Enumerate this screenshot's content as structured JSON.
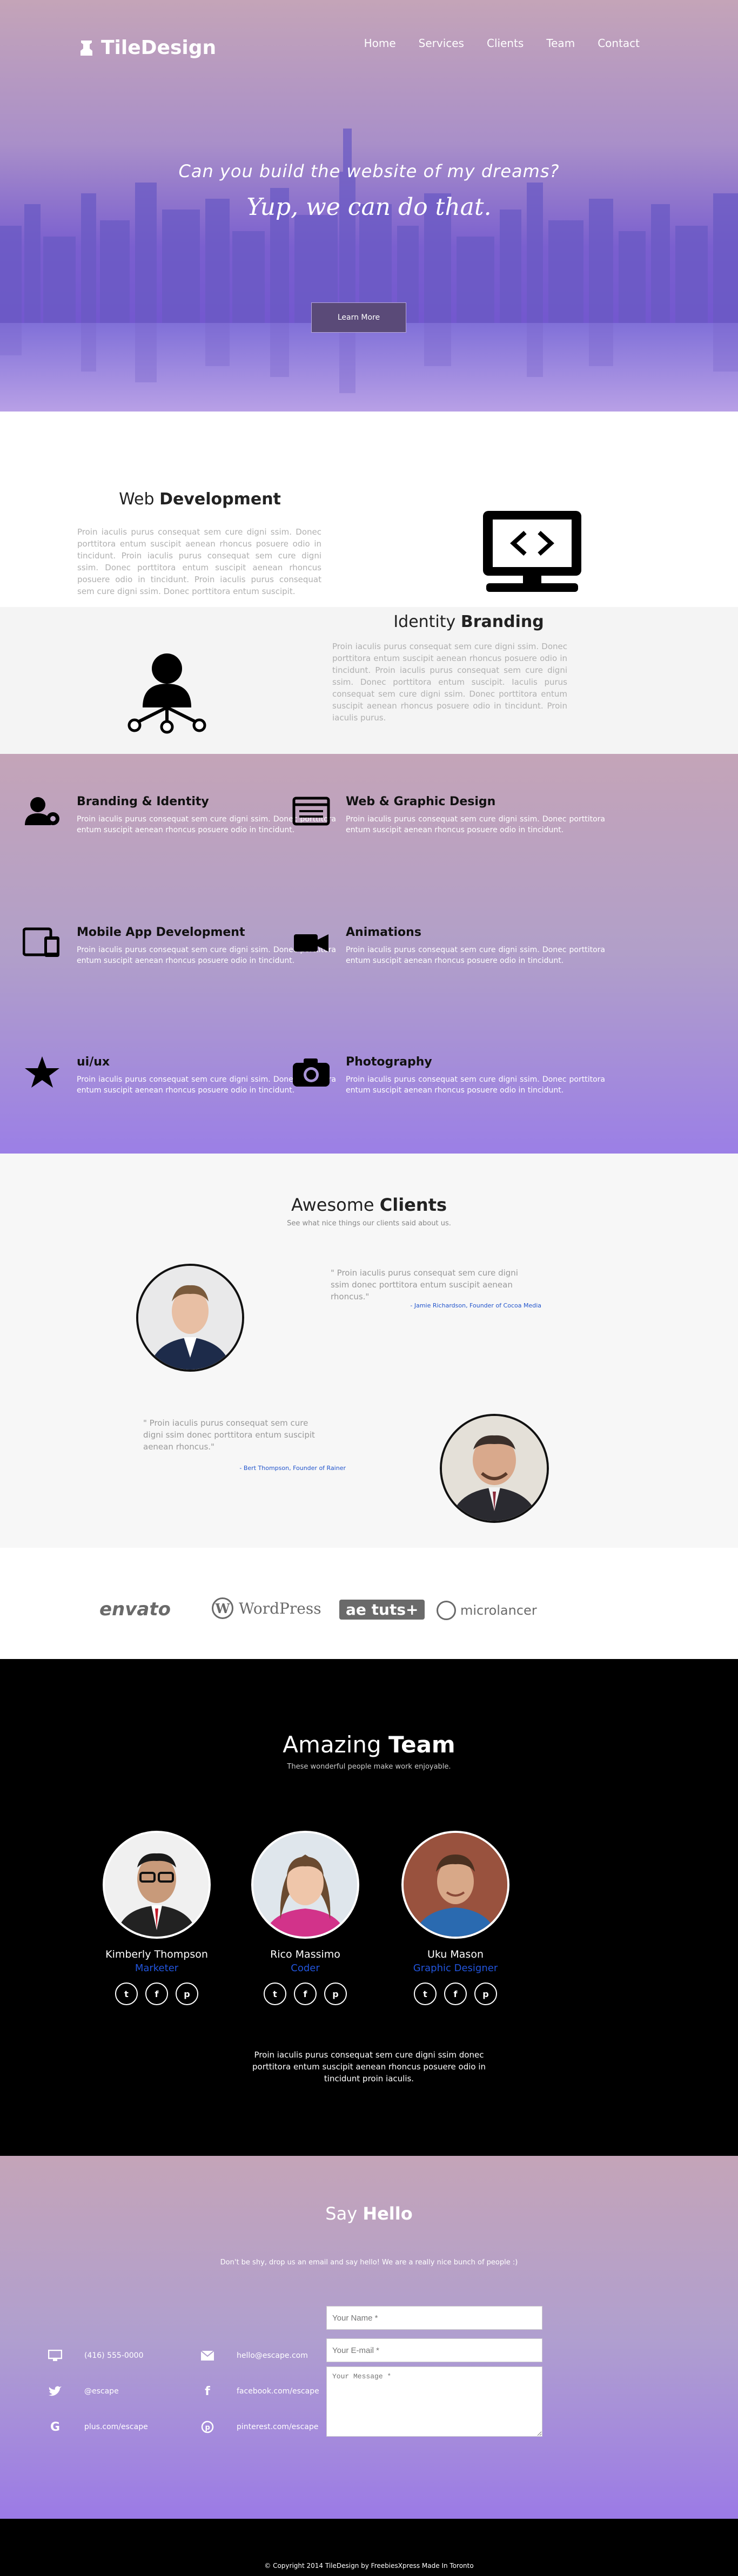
{
  "header": {
    "logo_text": "TileDesign",
    "nav": [
      "Home",
      "Services",
      "Clients",
      "Team",
      "Contact"
    ]
  },
  "hero": {
    "question": "Can you build the website of my dreams?",
    "answer": "Yup, we can do that.",
    "button": "Learn More"
  },
  "services": {
    "web_dev": {
      "title_a": "Web ",
      "title_b": "Development",
      "text": "Proin iaculis purus consequat sem cure digni ssim. Donec porttitora entum suscipit aenean rhoncus posuere odio in tincidunt. Proin iaculis purus consequat sem cure digni ssim. Donec porttitora entum suscipit aenean rhoncus posuere odio in tincidunt. Proin iaculis purus consequat sem cure digni ssim. Donec porttitora entum suscipit."
    },
    "branding": {
      "title_a": "Identity ",
      "title_b": "Branding",
      "text": "Proin iaculis purus consequat sem cure digni ssim. Donec porttitora entum suscipit aenean rhoncus posuere odio in tincidunt. Proin iaculis purus consequat sem cure digni ssim. Donec porttitora entum suscipit. Iaculis purus consequat sem cure digni ssim. Donec porttitora entum suscipit aenean rhoncus posuere odio in tincidunt. Proin iaculis purus."
    }
  },
  "features": [
    {
      "title": "Branding & Identity",
      "icon": "branding-icon",
      "text": "Proin iaculis purus consequat sem cure digni ssim. Donec porttitora entum suscipit aenean rhoncus posuere odio in tincidunt."
    },
    {
      "title": "Web & Graphic Design",
      "icon": "browser-icon",
      "text": "Proin iaculis purus consequat sem cure digni ssim. Donec porttitora entum suscipit aenean rhoncus posuere odio in tincidunt."
    },
    {
      "title": "Mobile App Development",
      "icon": "devices-icon",
      "text": "Proin iaculis purus consequat sem cure digni ssim. Donec porttitora entum suscipit aenean rhoncus posuere odio in tincidunt."
    },
    {
      "title": "Animations",
      "icon": "video-camera-icon",
      "text": "Proin iaculis purus consequat sem cure digni ssim. Donec porttitora entum suscipit aenean rhoncus posuere odio in tincidunt."
    },
    {
      "title": "ui/ux",
      "icon": "star-icon",
      "text": "Proin iaculis purus consequat sem cure digni ssim. Donec porttitora entum suscipit aenean rhoncus posuere odio in tincidunt."
    },
    {
      "title": "Photography",
      "icon": "camera-icon",
      "text": "Proin iaculis purus consequat sem cure digni ssim. Donec porttitora entum suscipit aenean rhoncus posuere odio in tincidunt."
    }
  ],
  "clients": {
    "title_a": "Awesome ",
    "title_b": "Clients",
    "subtitle": "See what nice things our clients said about us.",
    "testimonials": [
      {
        "quote": "\" Proin iaculis purus consequat sem cure digni ssim donec porttitora entum suscipit aenean rhoncus.\"",
        "author": "- Jamie Richardson, Founder of Cocoa Media"
      },
      {
        "quote": "\" Proin iaculis purus consequat sem cure digni ssim donec porttitora entum suscipit aenean rhoncus.\"",
        "author": "- Bert Thompson, Founder of Rainer"
      }
    ]
  },
  "logos": [
    "envato",
    "WordPress",
    "tuts+",
    "microlancer"
  ],
  "team": {
    "title_a": "Amazing ",
    "title_b": "Team",
    "subtitle": "These wonderful people make work enjoyable.",
    "members": [
      {
        "name": "Kimberly Thompson",
        "role": "Marketer"
      },
      {
        "name": "Rico Massimo",
        "role": "Coder"
      },
      {
        "name": "Uku Mason",
        "role": "Graphic Designer"
      }
    ],
    "text": "Proin iaculis purus consequat sem cure digni ssim donec porttitora entum suscipit aenean rhoncus posuere odio in tincidunt proin iaculis."
  },
  "contact": {
    "title_a": "Say ",
    "title_b": "Hello",
    "subtitle": "Don't be shy, drop us an email and say hello! We are a really nice bunch of people :)",
    "info": [
      {
        "icon": "monitor-icon",
        "text": "(416) 555-0000"
      },
      {
        "icon": "mail-icon",
        "text": "hello@escape.com"
      },
      {
        "icon": "twitter-icon",
        "text": "@escape"
      },
      {
        "icon": "facebook-icon",
        "text": "facebook.com/escape"
      },
      {
        "icon": "google-icon",
        "text": "plus.com/escape"
      },
      {
        "icon": "pinterest-icon",
        "text": "pinterest.com/escape"
      }
    ],
    "form": {
      "name_placeholder": "Your Name *",
      "email_placeholder": "Your E-mail *",
      "message_placeholder": "Your Message *"
    }
  },
  "footer": {
    "text": "© Copyright 2014 TileDesign by FreebiesXpress Made In Toronto"
  },
  "colors": {
    "accent_purple": "#9b7ae6",
    "link_blue": "#2255dd",
    "dark": "#000000"
  }
}
